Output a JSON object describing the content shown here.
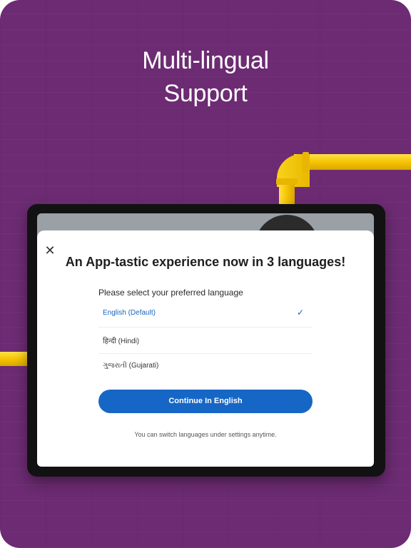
{
  "promo": {
    "headline_line1": "Multi-lingual",
    "headline_line2": "Support"
  },
  "dialog": {
    "close_icon": "close-icon",
    "title": "An App-tastic experience now in 3 languages!",
    "prompt": "Please select your preferred language",
    "languages": [
      {
        "label": "English (Default)",
        "selected": true
      },
      {
        "label": "हिन्दी (Hindi)",
        "selected": false
      },
      {
        "label": "ગુજરાતી (Gujarati)",
        "selected": false
      }
    ],
    "check_icon": "checkmark-icon",
    "continue_label": "Continue In English",
    "hint": "You can switch languages under settings anytime."
  },
  "colors": {
    "background": "#6c2b72",
    "accent": "#1666c6",
    "pipe": "#f6c400"
  }
}
